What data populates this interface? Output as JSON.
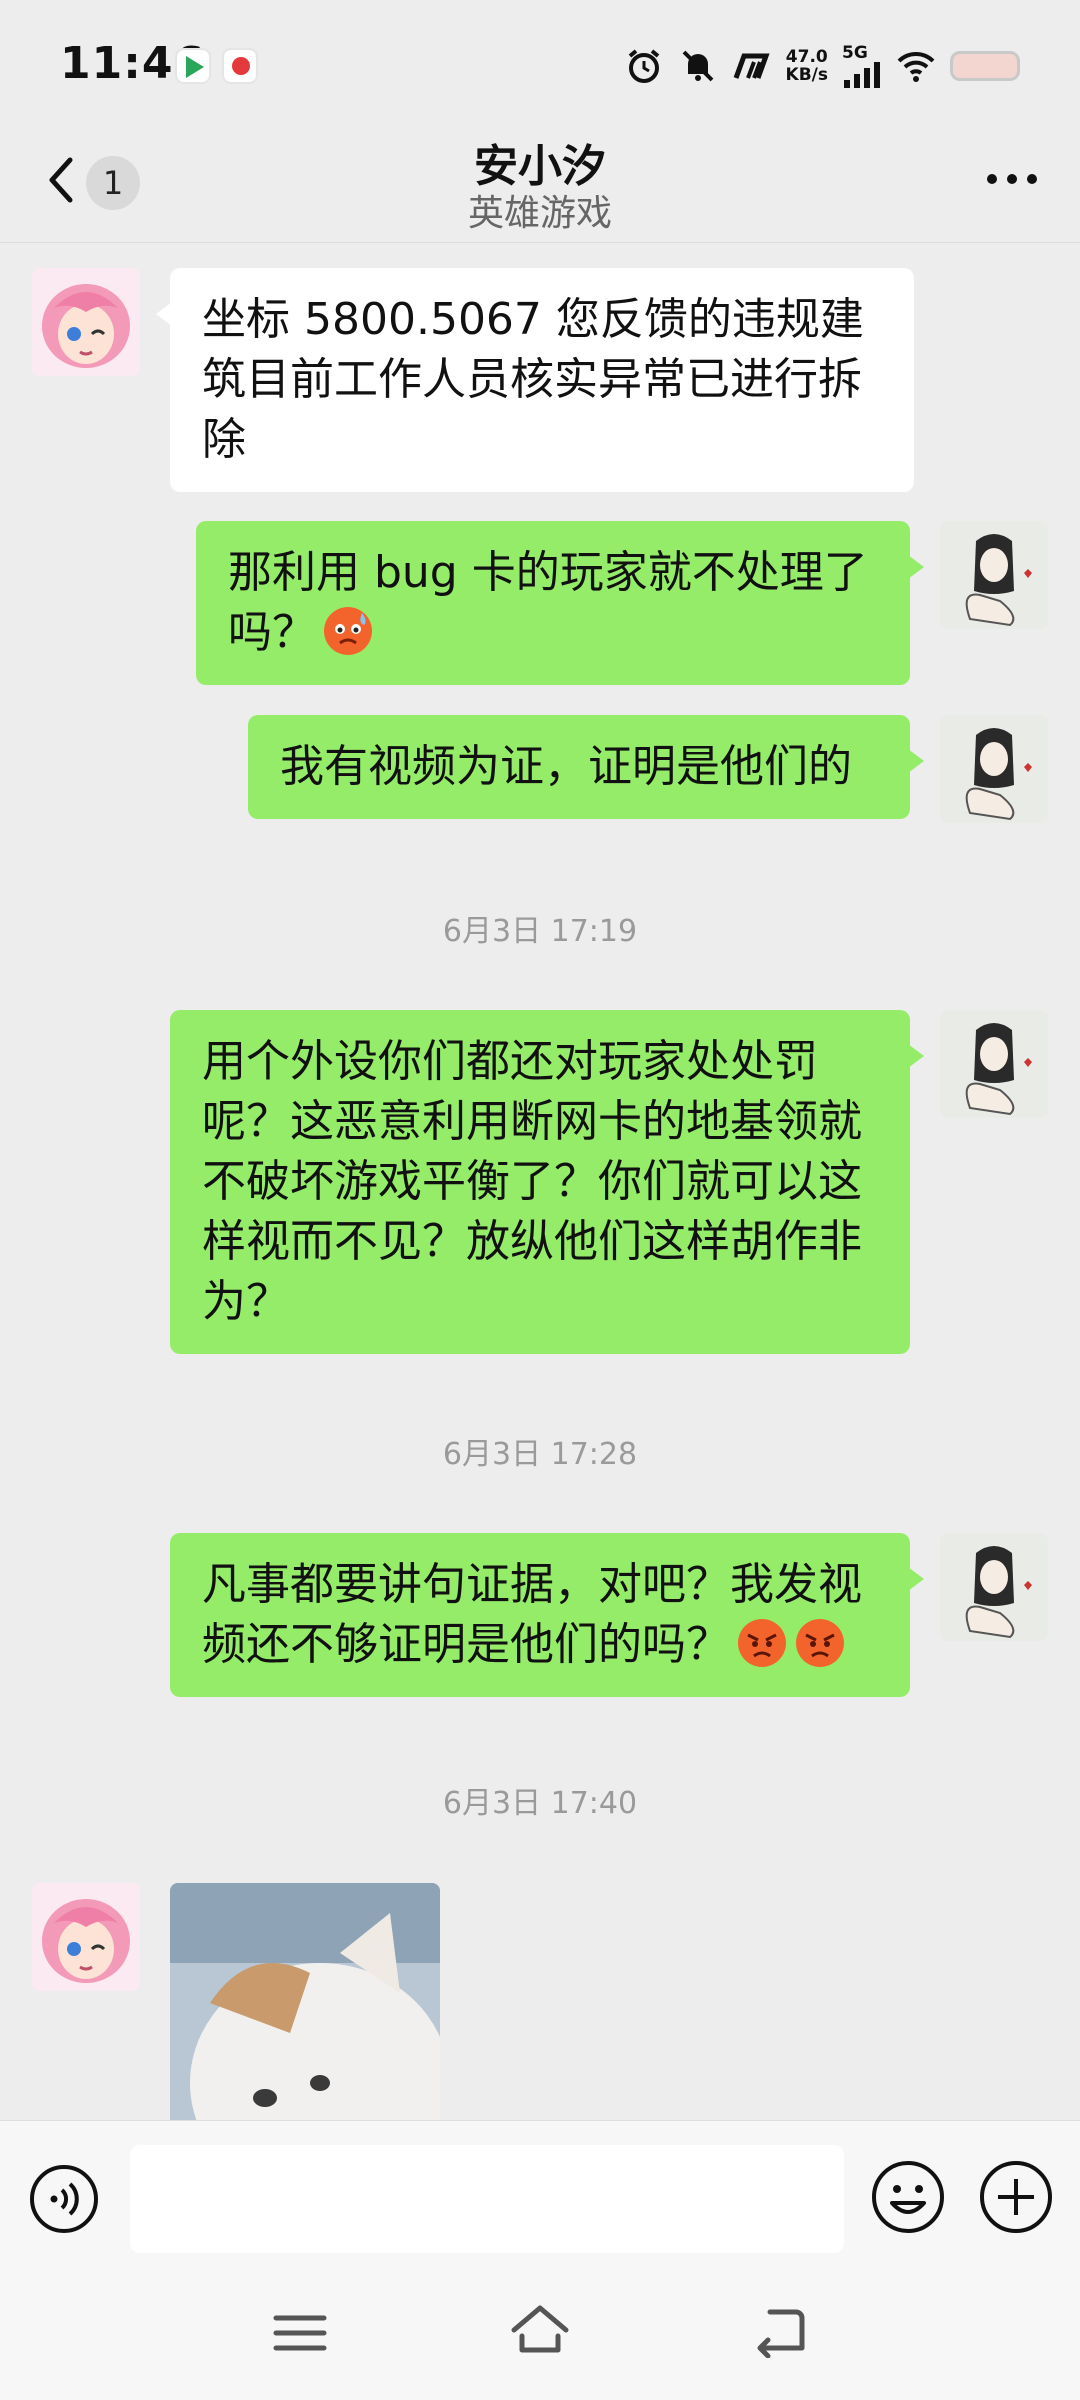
{
  "status_bar": {
    "time": "11:46",
    "net_speed_value": "47.0",
    "net_speed_unit": "KB/s",
    "network_type": "5G",
    "icons": [
      "alarm-icon",
      "mute-bell-icon",
      "hd-icon",
      "signal-icon",
      "wifi-icon",
      "battery-icon"
    ]
  },
  "header": {
    "unread_count": "1",
    "title": "安小汐",
    "subtitle": "英雄游戏"
  },
  "messages": [
    {
      "type": "text",
      "side": "left",
      "text": "坐标 5800.5067 您反馈的违规建筑目前工作人员核实异常已进行拆除"
    },
    {
      "type": "text",
      "side": "right",
      "text": "那利用 bug 卡的玩家就不处理了吗？",
      "emojis": [
        "sweat-face-emoji"
      ]
    },
    {
      "type": "text",
      "side": "right",
      "text": "我有视频为证，证明是他们的"
    },
    {
      "type": "time",
      "text": "6月3日 17:19"
    },
    {
      "type": "text",
      "side": "right",
      "text": "用个外设你们都还对玩家处处罚呢？这恶意利用断网卡的地基领就不破坏游戏平衡了？你们就可以这样视而不见？放纵他们这样胡作非为？"
    },
    {
      "type": "time",
      "text": "6月3日 17:28"
    },
    {
      "type": "text",
      "side": "right",
      "text": "凡事都要讲句证据，对吧？我发视频还不够证明是他们的吗？",
      "emojis": [
        "angry-face-emoji",
        "angry-face-emoji"
      ]
    },
    {
      "type": "time",
      "text": "6月3日 17:40"
    },
    {
      "type": "image",
      "side": "left",
      "description_icon": "cat-photo"
    }
  ],
  "input_bar": {
    "text_value": "",
    "icons": [
      "voice-icon",
      "emoji-icon",
      "plus-icon"
    ]
  },
  "system_nav": {
    "icons": [
      "menu-icon",
      "home-icon",
      "back-icon"
    ]
  },
  "colors": {
    "background": "#ededed",
    "outgoing_bubble": "#95ec69",
    "incoming_bubble": "#ffffff",
    "timestamp": "#9a9a9a"
  }
}
